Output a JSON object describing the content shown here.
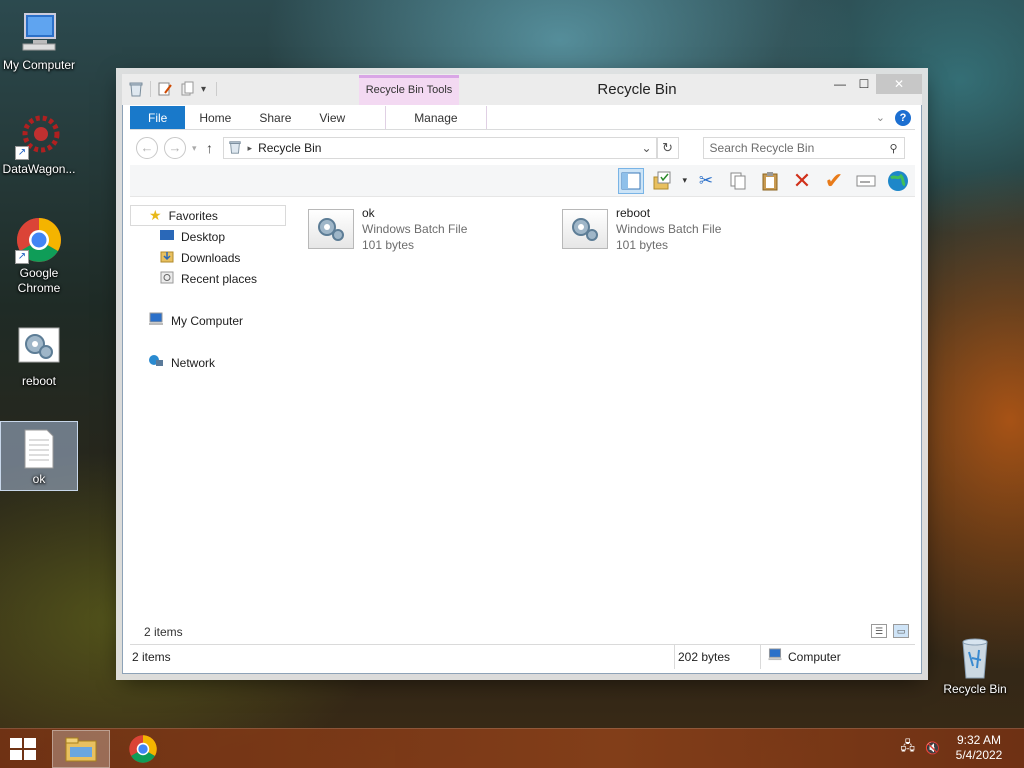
{
  "desktop": {
    "icons": [
      {
        "label": "My Computer"
      },
      {
        "label": "DataWagon..."
      },
      {
        "label": "Google Chrome"
      },
      {
        "label": "reboot"
      },
      {
        "label": "ok"
      }
    ],
    "recycle_bin_label": "Recycle Bin"
  },
  "window": {
    "title": "Recycle Bin",
    "context_group": "Recycle Bin Tools",
    "tabs": {
      "file": "File",
      "home": "Home",
      "share": "Share",
      "view": "View",
      "manage": "Manage"
    },
    "help": "?",
    "address": "Recycle Bin",
    "search_placeholder": "Search Recycle Bin",
    "nav": {
      "favorites": "Favorites",
      "desktop": "Desktop",
      "downloads": "Downloads",
      "recent": "Recent places",
      "computer": "My Computer",
      "network": "Network"
    },
    "files": [
      {
        "name": "ok",
        "type": "Windows Batch File",
        "size": "101 bytes"
      },
      {
        "name": "reboot",
        "type": "Windows Batch File",
        "size": "101 bytes"
      }
    ],
    "items_count": "2 items",
    "status": {
      "items": "2 items",
      "size": "202 bytes",
      "location": "Computer"
    }
  },
  "taskbar": {
    "time": "9:32 AM",
    "date": "5/4/2022"
  },
  "colors": {
    "accent": "#1979ca",
    "context_tab": "#f3d9f2",
    "taskbar": "#8a3f19"
  }
}
